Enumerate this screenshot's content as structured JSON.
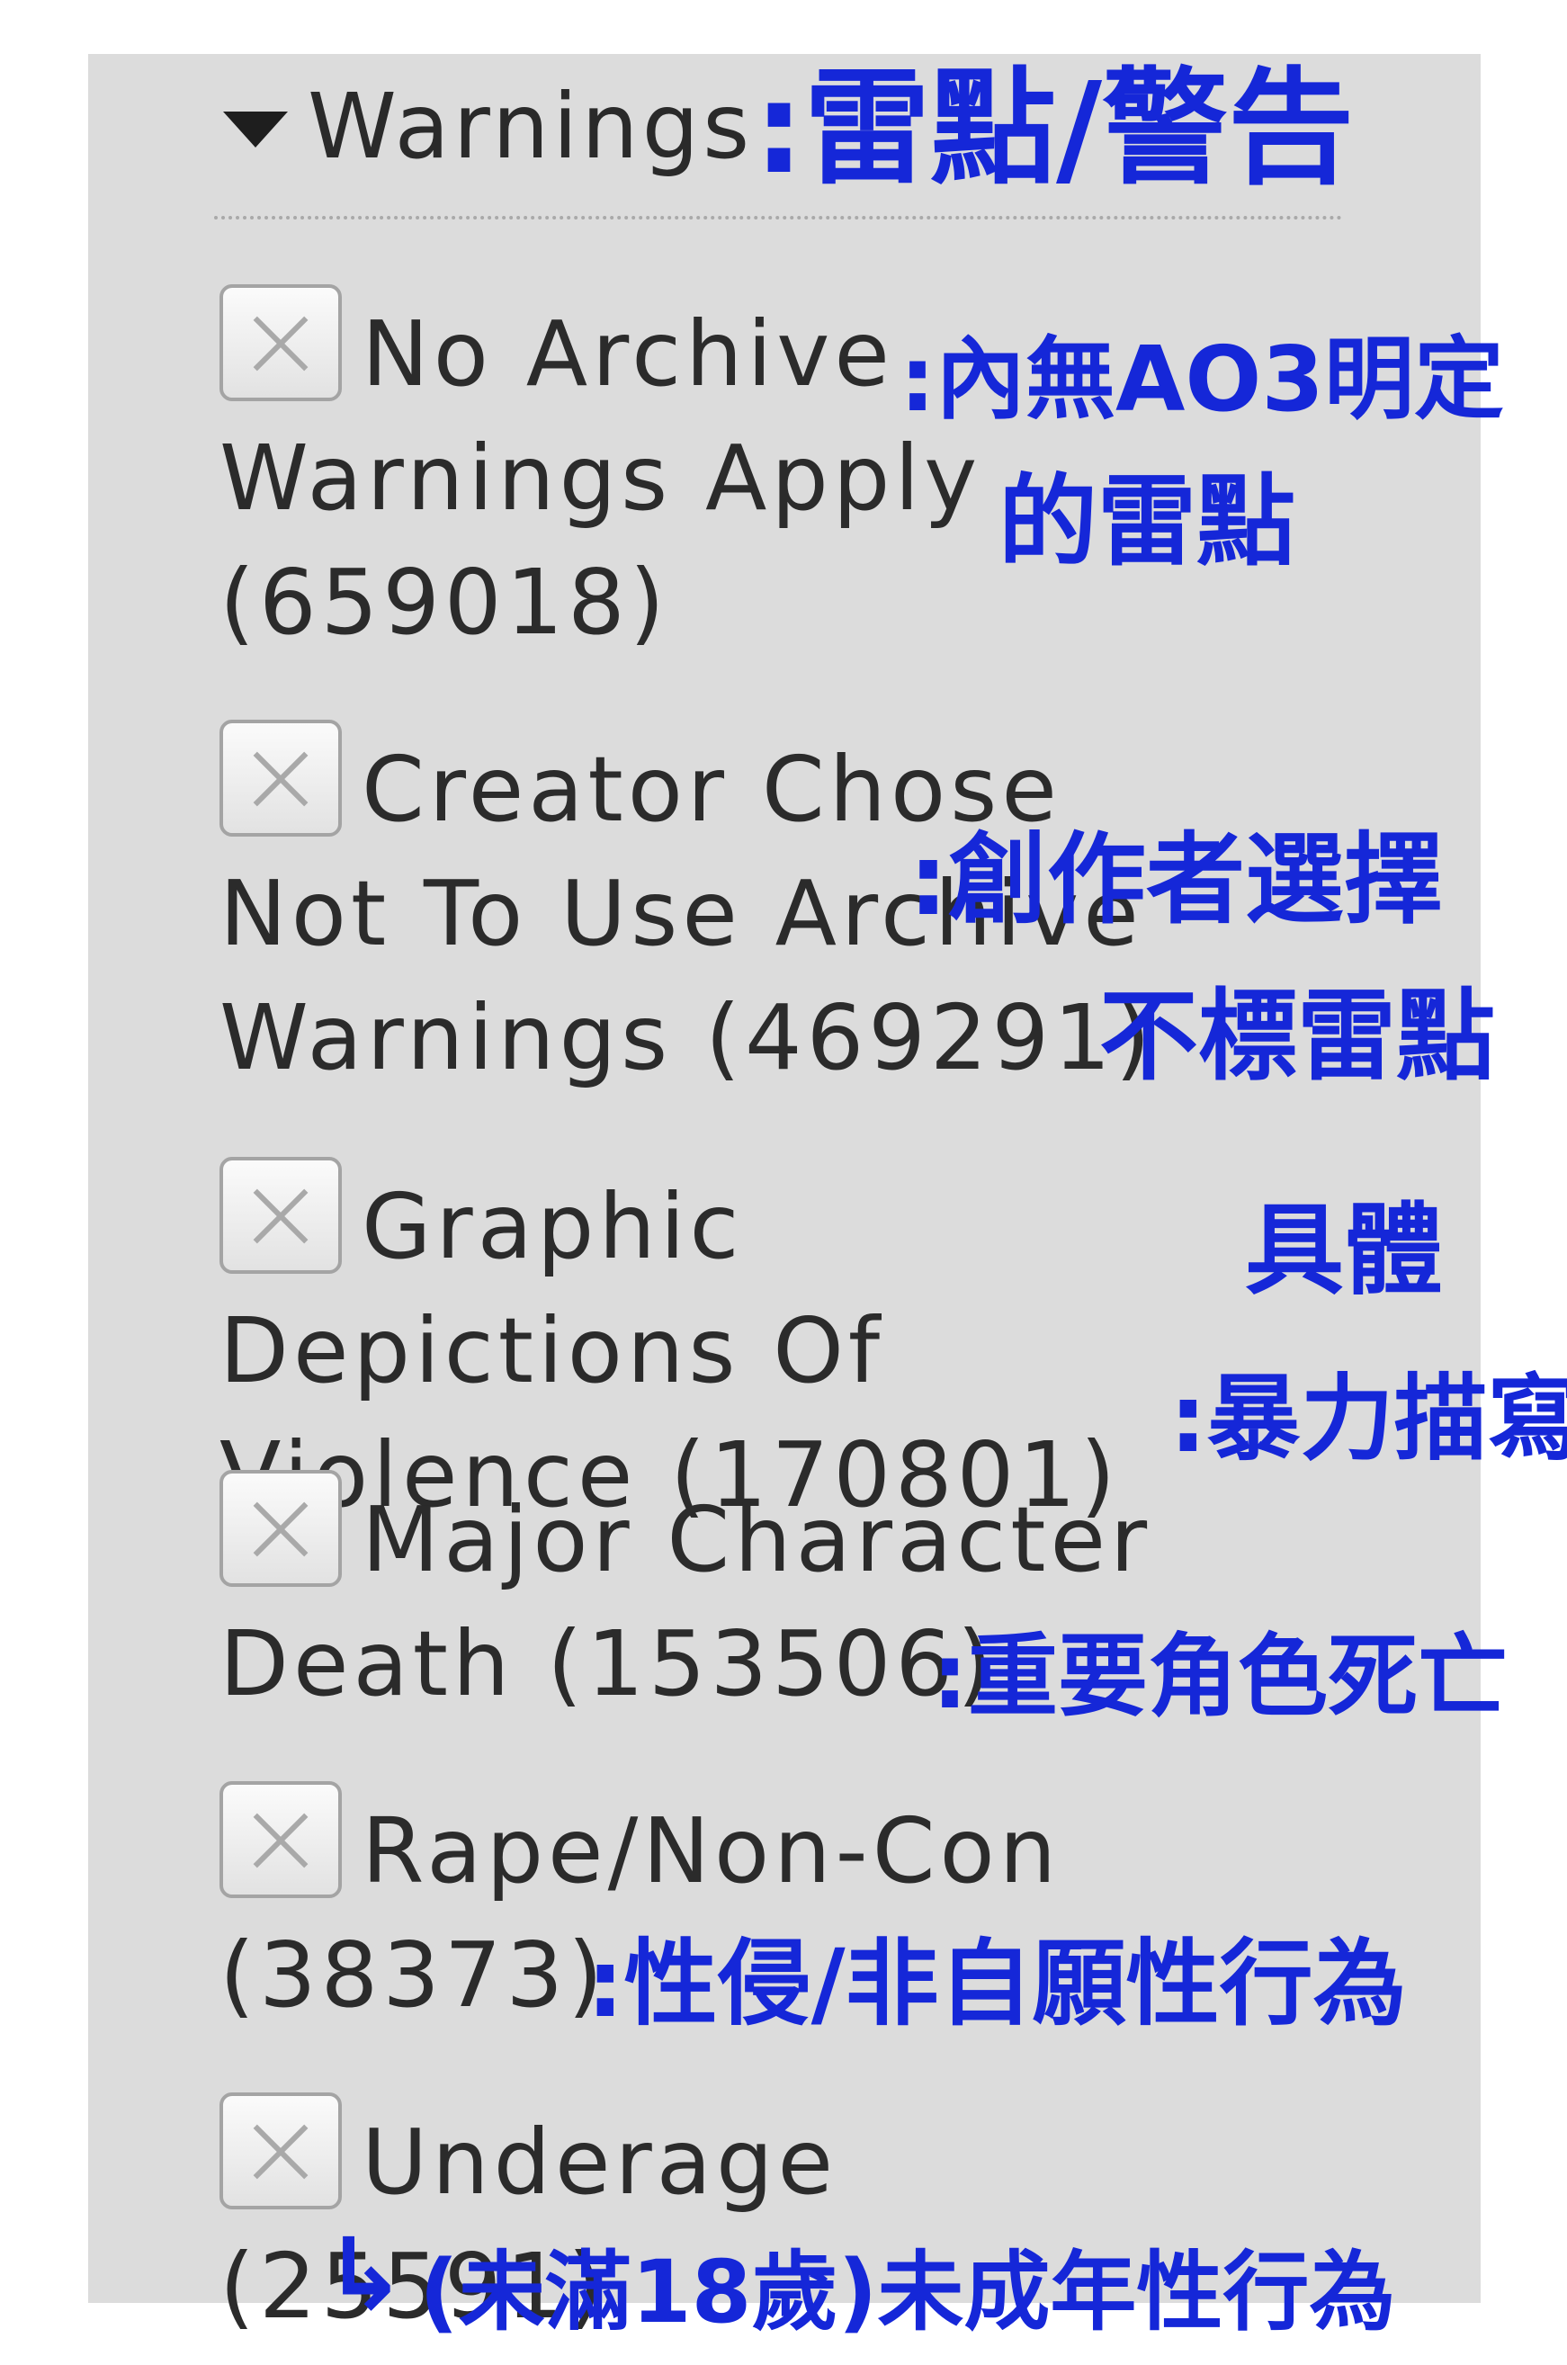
{
  "filter": {
    "header": "Warnings",
    "items": [
      {
        "label": "No Archive Warnings Apply",
        "count": "(659018)",
        "checked": false
      },
      {
        "label": "Creator Chose Not To Use Archive Warnings",
        "count": "(469291)",
        "checked": false
      },
      {
        "label": "Graphic Depictions Of Violence",
        "count": "(170801)",
        "checked": false
      },
      {
        "label": "Major Character Death",
        "count": "(153506)",
        "checked": false
      },
      {
        "label": "Rape/Non-Con",
        "count": "(38373)",
        "checked": false
      },
      {
        "label": "Underage",
        "count": "(25591)",
        "checked": false
      }
    ]
  },
  "annotations": {
    "header": ":雷點/警告",
    "no_archive_1": ":內無AO3明定",
    "no_archive_2": "的雷點",
    "creator_1": ":創作者選擇",
    "creator_2": "不標雷點",
    "graphic_1": "具體",
    "graphic_2": ":暴力描寫",
    "major": ":重要角色死亡",
    "rape": ":性侵/非自願性行為",
    "underage_arrow": "↳",
    "underage": "(未滿18歲)未成年性行為"
  },
  "colors": {
    "panel": "#dcdcdc",
    "annotation_ink": "#1527d8",
    "checkbox_x": "#a9a9a9"
  },
  "icons": {
    "toggle": "triangle-down-icon",
    "checkbox_mark": "x-mark-icon"
  }
}
